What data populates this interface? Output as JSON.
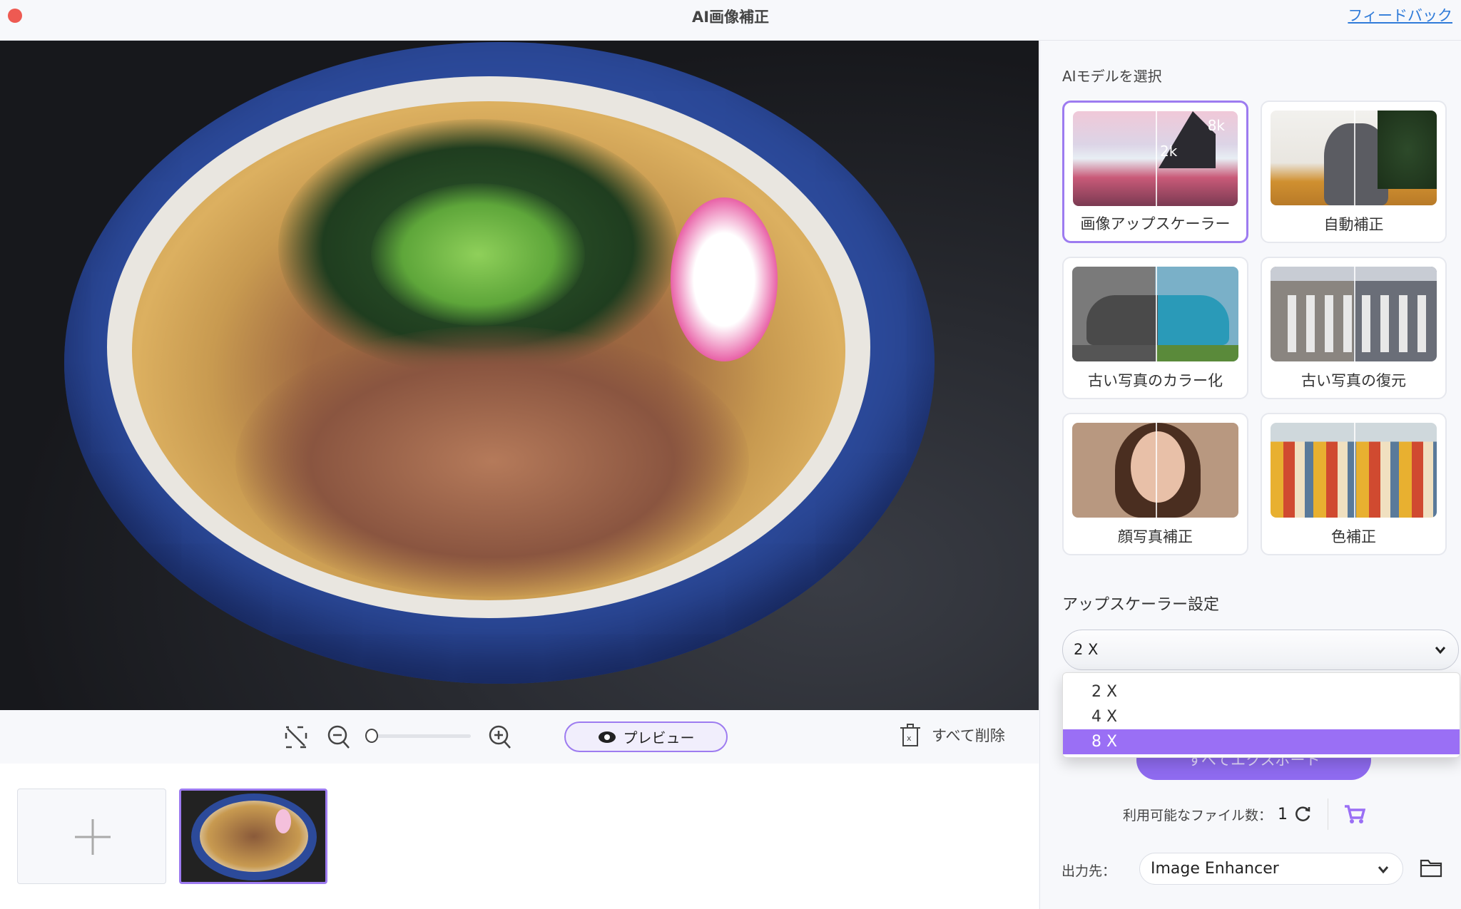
{
  "window": {
    "title": "AI画像補正",
    "feedback": "フィードバック"
  },
  "toolbar": {
    "preview": "プレビュー",
    "delete_all": "すべて削除",
    "zoom_level": 0
  },
  "panel": {
    "model_heading": "AIモデルを選択",
    "models": [
      {
        "label": "画像アップスケーラー",
        "selected": true,
        "badge_hi": "8k",
        "badge_lo": "2k"
      },
      {
        "label": "自動補正",
        "selected": false
      },
      {
        "label": "古い写真のカラー化",
        "selected": false
      },
      {
        "label": "古い写真の復元",
        "selected": false
      },
      {
        "label": "顔写真補正",
        "selected": false
      },
      {
        "label": "色補正",
        "selected": false
      }
    ],
    "settings_heading": "アップスケーラー設定",
    "scale_value": "2 X",
    "scale_options": [
      "2 X",
      "4 X",
      "8 X"
    ],
    "highlighted_option": "8 X",
    "export": "すべてエクスポート",
    "files_label": "利用可能なファイル数：",
    "files_count": "1",
    "output_label": "出力先：",
    "output_value": "Image Enhancer"
  },
  "colors": {
    "accent": "#9a6ff5",
    "link": "#2f7bd9"
  }
}
